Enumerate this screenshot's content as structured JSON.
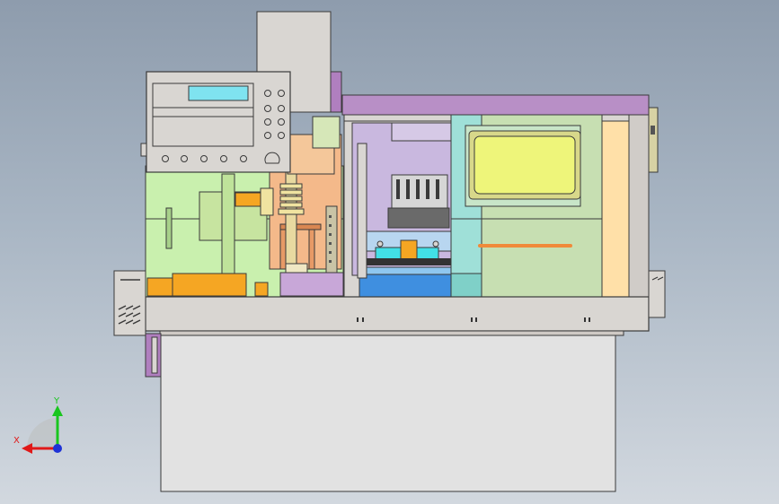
{
  "triad": {
    "x_label": "X",
    "y_label": "Y"
  },
  "colors": {
    "background_top": "#8e9cad",
    "background_bottom": "#d2d8df",
    "housing": "#d9d6d2",
    "outline": "#3a3a3a",
    "magenta": "#b07fbf",
    "light_green": "#c9f0ae",
    "orange": "#f5a623",
    "salmon": "#f4b98a",
    "yellow_window": "#eef57a",
    "teal_panel": "#9fe0d8",
    "blue_base": "#3f8fe0",
    "cyan": "#42e0e6",
    "axis_x": "#e01818",
    "axis_y": "#19c61e",
    "axis_z": "#1e32d6"
  }
}
